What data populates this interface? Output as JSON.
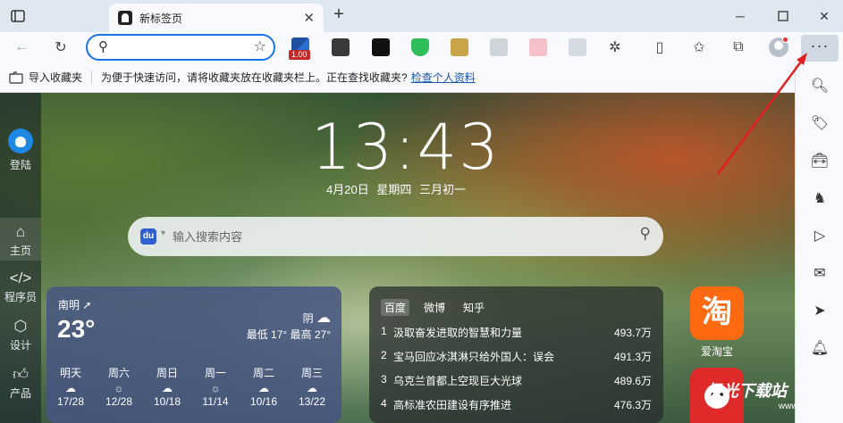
{
  "tab": {
    "title": "新标签页"
  },
  "address": {
    "placeholder": ""
  },
  "extensions": {
    "badge": "1.00"
  },
  "favbar": {
    "import_label": "导入收藏夹",
    "hint": "为便于快速访问，请将收藏夹放在收藏夹栏上。正在查找收藏夹?",
    "link": "检查个人资料"
  },
  "leftrail": {
    "login": "登陆",
    "items": [
      {
        "label": "主页",
        "icon": "home-icon"
      },
      {
        "label": "程序员",
        "icon": "code-icon"
      },
      {
        "label": "设计",
        "icon": "cube-icon"
      },
      {
        "label": "产品",
        "icon": "thumb-up-icon"
      }
    ]
  },
  "clock": {
    "time": "13:43",
    "date": "4月20日  星期四  三月初一"
  },
  "search": {
    "engine_icon": "du",
    "placeholder": "输入搜索内容"
  },
  "weather": {
    "city": "南明",
    "temp": "23°",
    "condition": "阴",
    "range": "最低 17° 最高 27°",
    "forecast": [
      {
        "day": "明天",
        "temps": "17/28"
      },
      {
        "day": "周六",
        "temps": "12/28"
      },
      {
        "day": "周日",
        "temps": "10/18"
      },
      {
        "day": "周一",
        "temps": "11/14"
      },
      {
        "day": "周二",
        "temps": "10/16"
      },
      {
        "day": "周三",
        "temps": "13/22"
      }
    ]
  },
  "news": {
    "tabs": [
      "百度",
      "微博",
      "知乎"
    ],
    "items": [
      {
        "rank": "1",
        "title": "汲取奋发进取的智慧和力量",
        "heat": "493.7万"
      },
      {
        "rank": "2",
        "title": "宝马回应冰淇淋只给外国人：误会",
        "heat": "491.3万"
      },
      {
        "rank": "3",
        "title": "乌克兰首都上空现巨大光球",
        "heat": "489.6万"
      },
      {
        "rank": "4",
        "title": "高标准农田建设有序推进",
        "heat": "476.3万"
      }
    ]
  },
  "apps": [
    {
      "label": "爱淘宝",
      "glyph": "淘",
      "color": "#ff6a10"
    },
    {
      "label": "",
      "glyph": "",
      "color": "#e02a2a"
    }
  ],
  "watermark": {
    "text": "极光下载站",
    "sub": "www.xz7.com"
  }
}
